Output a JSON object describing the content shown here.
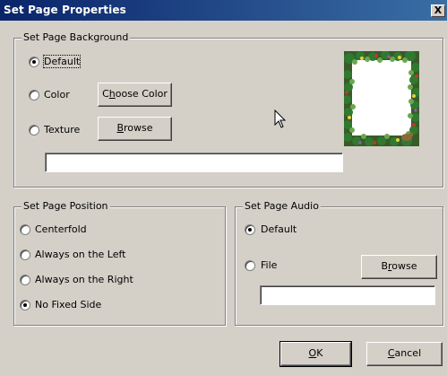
{
  "window": {
    "title": "Set Page Properties",
    "close_glyph": "X"
  },
  "background_group": {
    "legend": "Set Page Background",
    "options": [
      {
        "label": "Default",
        "checked": true
      },
      {
        "label": "Color",
        "checked": false
      },
      {
        "label": "Texture",
        "checked": false
      }
    ],
    "choose_color": {
      "pre": "C",
      "mnemonic": "h",
      "post": "oose Color"
    },
    "browse": {
      "pre": "",
      "mnemonic": "B",
      "post": "rowse"
    },
    "texture_path": "",
    "preview_icon": "page-background-preview"
  },
  "position_group": {
    "legend": "Set Page Position",
    "options": [
      {
        "label": "Centerfold",
        "checked": false
      },
      {
        "label": "Always on the Left",
        "checked": false
      },
      {
        "label": "Always on the Right",
        "checked": false
      },
      {
        "label": "No Fixed Side",
        "checked": true
      }
    ]
  },
  "audio_group": {
    "legend": "Set Page Audio",
    "options": [
      {
        "label": "Default",
        "checked": true
      },
      {
        "label": "File",
        "checked": false
      }
    ],
    "browse": {
      "pre": "B",
      "mnemonic": "r",
      "post": "owse"
    },
    "file_path": ""
  },
  "footer": {
    "ok": {
      "pre": "",
      "mnemonic": "O",
      "post": "K"
    },
    "cancel": {
      "pre": "",
      "mnemonic": "C",
      "post": "ancel"
    }
  },
  "colors": {
    "title_start": "#0a246a",
    "title_end": "#3a6ea5",
    "face": "#d4d0c8"
  }
}
